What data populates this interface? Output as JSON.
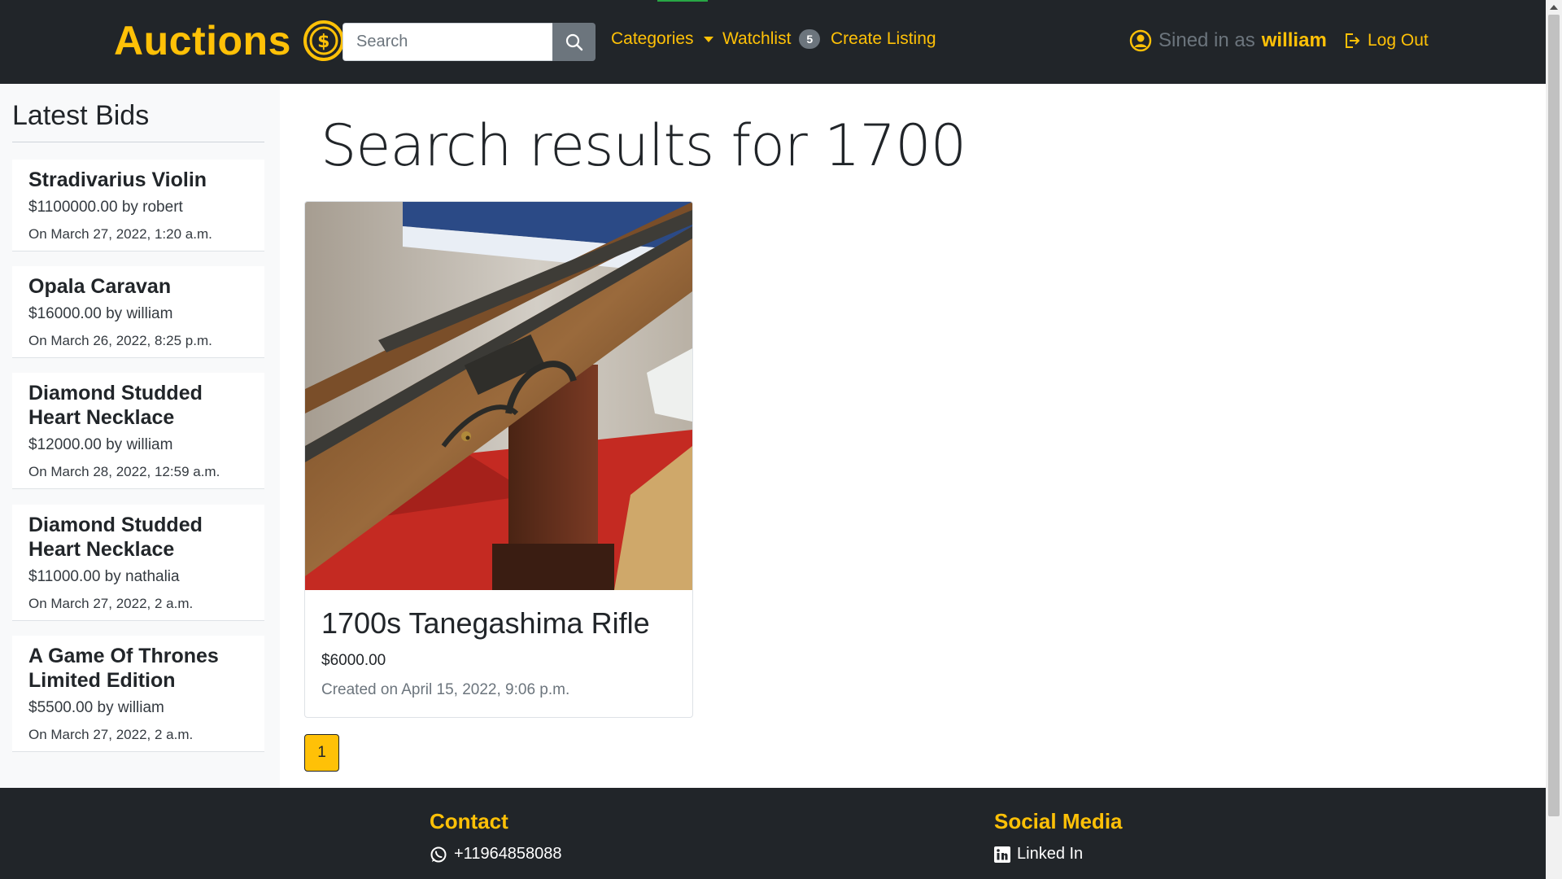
{
  "navbar": {
    "brand": "Auctions",
    "search_placeholder": "Search",
    "categories_label": "Categories",
    "watchlist_label": "Watchlist",
    "watchlist_count": "5",
    "create_listing_label": "Create Listing",
    "signed_in_text": "Sined in as",
    "username": "william",
    "logout_label": "Log Out"
  },
  "sidebar": {
    "title": "Latest Bids",
    "bids": [
      {
        "title": "Stradivarius Violin",
        "amount": "$1100000.00 by robert",
        "date": "On March 27, 2022, 1:20 a.m."
      },
      {
        "title": "Opala Caravan",
        "amount": "$16000.00 by william",
        "date": "On March 26, 2022, 8:25 p.m."
      },
      {
        "title": "Diamond Studded Heart Necklace",
        "amount": "$12000.00 by william",
        "date": "On March 28, 2022, 12:59 a.m."
      },
      {
        "title": "Diamond Studded Heart Necklace",
        "amount": "$11000.00 by nathalia",
        "date": "On March 27, 2022, 2 a.m."
      },
      {
        "title": "A Game Of Thrones Limited Edition",
        "amount": "$5500.00 by william",
        "date": "On March 27, 2022, 2 a.m."
      }
    ]
  },
  "main": {
    "results_title": "Search results for 1700",
    "listing": {
      "title": "1700s Tanegashima Rifle",
      "price": "$6000.00",
      "created": "Created on April 15, 2022, 9:06 p.m."
    },
    "page": "1"
  },
  "footer": {
    "contact_heading": "Contact",
    "phone": "+11964858088",
    "social_heading": "Social Media",
    "linkedin": "Linked In"
  },
  "colors": {
    "navbar_bg": "#212529",
    "accent": "#ffc107",
    "muted": "#6c757d",
    "sidebar_bg": "#f8f9fa"
  },
  "icons": [
    "coin-dollar-icon",
    "search-icon",
    "user-circle-icon",
    "logout-icon",
    "whatsapp-icon",
    "linkedin-icon"
  ]
}
